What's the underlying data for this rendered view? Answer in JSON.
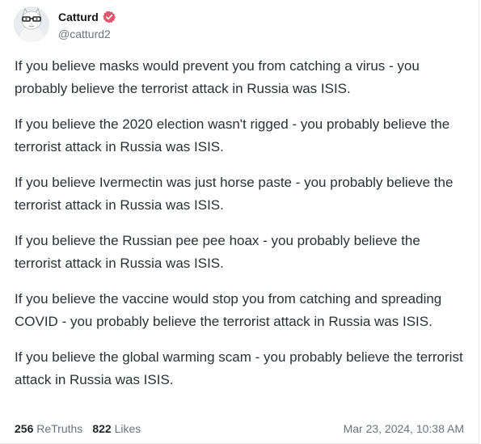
{
  "post": {
    "author": {
      "display_name": "Catturd",
      "handle": "@catturd2",
      "verified_badge": "verified-badge-icon",
      "badge_color": "#e0566c"
    },
    "paragraphs": [
      "If you believe masks would prevent you from catching a virus - you probably believe the terrorist attack in Russia was ISIS.",
      "If you believe the 2020 election wasn't rigged - you probably believe the terrorist attack in Russia was ISIS.",
      "If you believe Ivermectin was just horse paste - you probably believe the terrorist attack in Russia was ISIS.",
      "If you believe the Russian pee pee hoax - you probably believe the terrorist attack in Russia was ISIS.",
      "If you believe the vaccine would stop you from catching and spreading COVID - you probably believe the terrorist attack in Russia was ISIS.",
      "If you believe the global warming scam - you probably believe the terrorist attack in Russia was ISIS."
    ],
    "stats": {
      "retruths_count": "256",
      "retruths_label": "ReTruths",
      "likes_count": "822",
      "likes_label": "Likes"
    },
    "timestamp": "Mar 23, 2024, 10:38 AM"
  }
}
